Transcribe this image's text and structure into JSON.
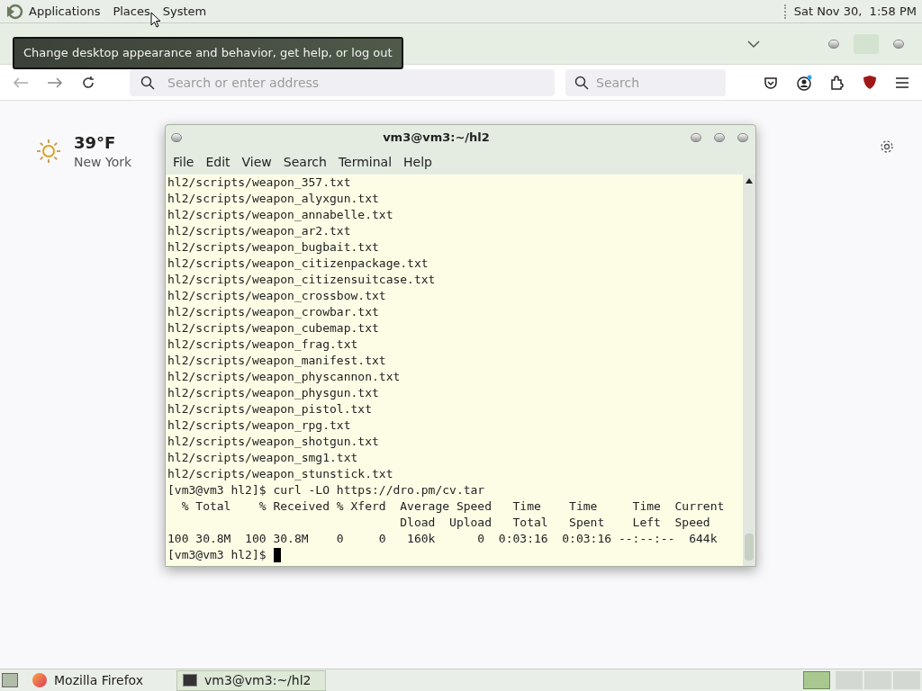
{
  "top_panel": {
    "menus": [
      "Applications",
      "Places",
      "System"
    ],
    "clock": "Sat Nov 30,  1:58 PM"
  },
  "tooltip": {
    "text": "Change desktop appearance and behavior, get help, or log out"
  },
  "browser": {
    "address": {
      "placeholder": "Search or enter address"
    },
    "search": {
      "placeholder": "Search"
    },
    "weather": {
      "temperature": "39°F",
      "city": "New York"
    }
  },
  "terminal": {
    "title": "vm3@vm3:~/hl2",
    "menus": [
      "File",
      "Edit",
      "View",
      "Search",
      "Terminal",
      "Help"
    ],
    "lines": [
      "hl2/scripts/weapon_357.txt",
      "hl2/scripts/weapon_alyxgun.txt",
      "hl2/scripts/weapon_annabelle.txt",
      "hl2/scripts/weapon_ar2.txt",
      "hl2/scripts/weapon_bugbait.txt",
      "hl2/scripts/weapon_citizenpackage.txt",
      "hl2/scripts/weapon_citizensuitcase.txt",
      "hl2/scripts/weapon_crossbow.txt",
      "hl2/scripts/weapon_crowbar.txt",
      "hl2/scripts/weapon_cubemap.txt",
      "hl2/scripts/weapon_frag.txt",
      "hl2/scripts/weapon_manifest.txt",
      "hl2/scripts/weapon_physcannon.txt",
      "hl2/scripts/weapon_physgun.txt",
      "hl2/scripts/weapon_pistol.txt",
      "hl2/scripts/weapon_rpg.txt",
      "hl2/scripts/weapon_shotgun.txt",
      "hl2/scripts/weapon_smg1.txt",
      "hl2/scripts/weapon_stunstick.txt",
      "[vm3@vm3 hl2]$ curl -LO https://dro.pm/cv.tar",
      "  % Total    % Received % Xferd  Average Speed   Time    Time     Time  Current",
      "                                 Dload  Upload   Total   Spent    Left  Speed",
      "100 30.8M  100 30.8M    0     0   160k      0  0:03:16  0:03:16 --:--:--  644k"
    ],
    "prompt": "[vm3@vm3 hl2]$"
  },
  "taskbar": {
    "items": [
      {
        "label": "Mozilla Firefox",
        "kind": "firefox",
        "selected": false
      },
      {
        "label": "vm3@vm3:~/hl2",
        "kind": "terminal",
        "selected": true
      }
    ]
  }
}
